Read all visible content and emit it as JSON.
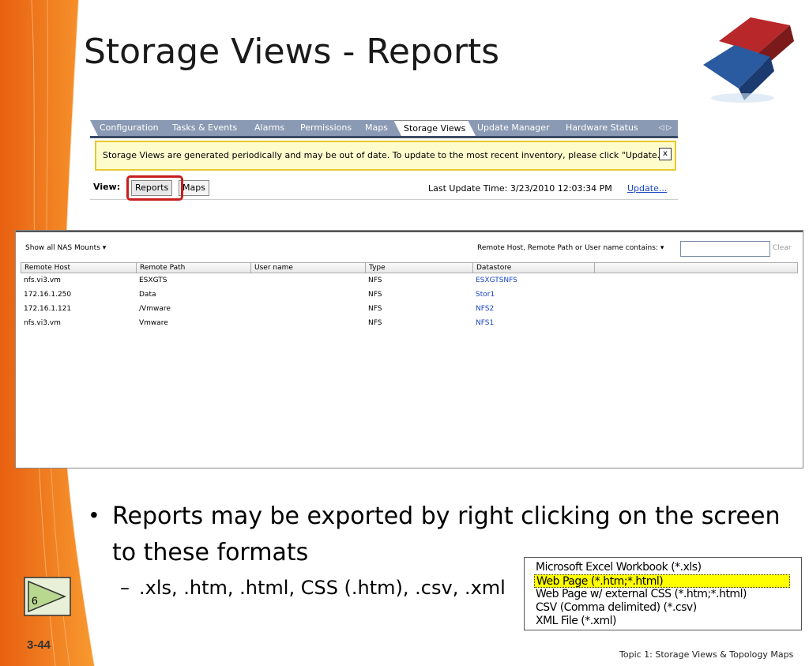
{
  "slide": {
    "title": "Storage Views - Reports",
    "number": "3-44",
    "footer": "Topic 1:  Storage Views & Topology Maps",
    "nav_button_label": "6"
  },
  "vsphere": {
    "tabs": [
      "Configuration",
      "Tasks & Events",
      "Alarms",
      "Permissions",
      "Maps",
      "Storage Views",
      "Update Manager",
      "Hardware Status"
    ],
    "active_tab": "Storage Views",
    "tab_scroll": "◁ ▷",
    "notice_text": "Storage Views are generated periodically and may be out of date. To update to the most recent inventory, please click \"Update...\"",
    "notice_close": "x",
    "view_label": "View:",
    "view_reports": "Reports",
    "view_maps": "Maps",
    "last_update": "Last Update Time: 3/23/2010 12:03:34 PM",
    "update_link": "Update..."
  },
  "report": {
    "show_all": "Show all NAS Mounts  ▾",
    "filter_label": "Remote Host, Remote Path or User name contains: ▾",
    "filter_value": "",
    "clear": "Clear",
    "columns": [
      "Remote Host",
      "Remote Path",
      "User name",
      "Type",
      "Datastore"
    ],
    "rows": [
      [
        "nfs.vi3.vm",
        "ESXGTS",
        "",
        "NFS",
        "ESXGTSNFS"
      ],
      [
        "172.16.1.250",
        "Data",
        "",
        "NFS",
        "Stor1"
      ],
      [
        "172.16.1.121",
        "/Vmware",
        "",
        "NFS",
        "NFS2"
      ],
      [
        "nfs.vi3.vm",
        "Vmware",
        "",
        "NFS",
        "NFS1"
      ]
    ]
  },
  "bullets": {
    "line1": "Reports may be exported by right clicking on the screen",
    "line2": "to these formats",
    "sub_dash": "–",
    "sub": ".xls, .htm, .html, CSS (.htm), .csv, .xml"
  },
  "export_formats": [
    "Microsoft Excel Workbook (*.xls)",
    "Web Page (*.htm;*.html)",
    "Web Page w/ external CSS (*.htm;*.html)",
    "CSV (Comma delimited) (*.csv)",
    "XML File (*.xml)"
  ],
  "colors": {
    "orange": "#f07820",
    "highlight_red": "#c81e1e",
    "tab_blue": "#8a9ab4",
    "link_blue": "#1a45c8",
    "selected_yellow": "#ffff00"
  }
}
